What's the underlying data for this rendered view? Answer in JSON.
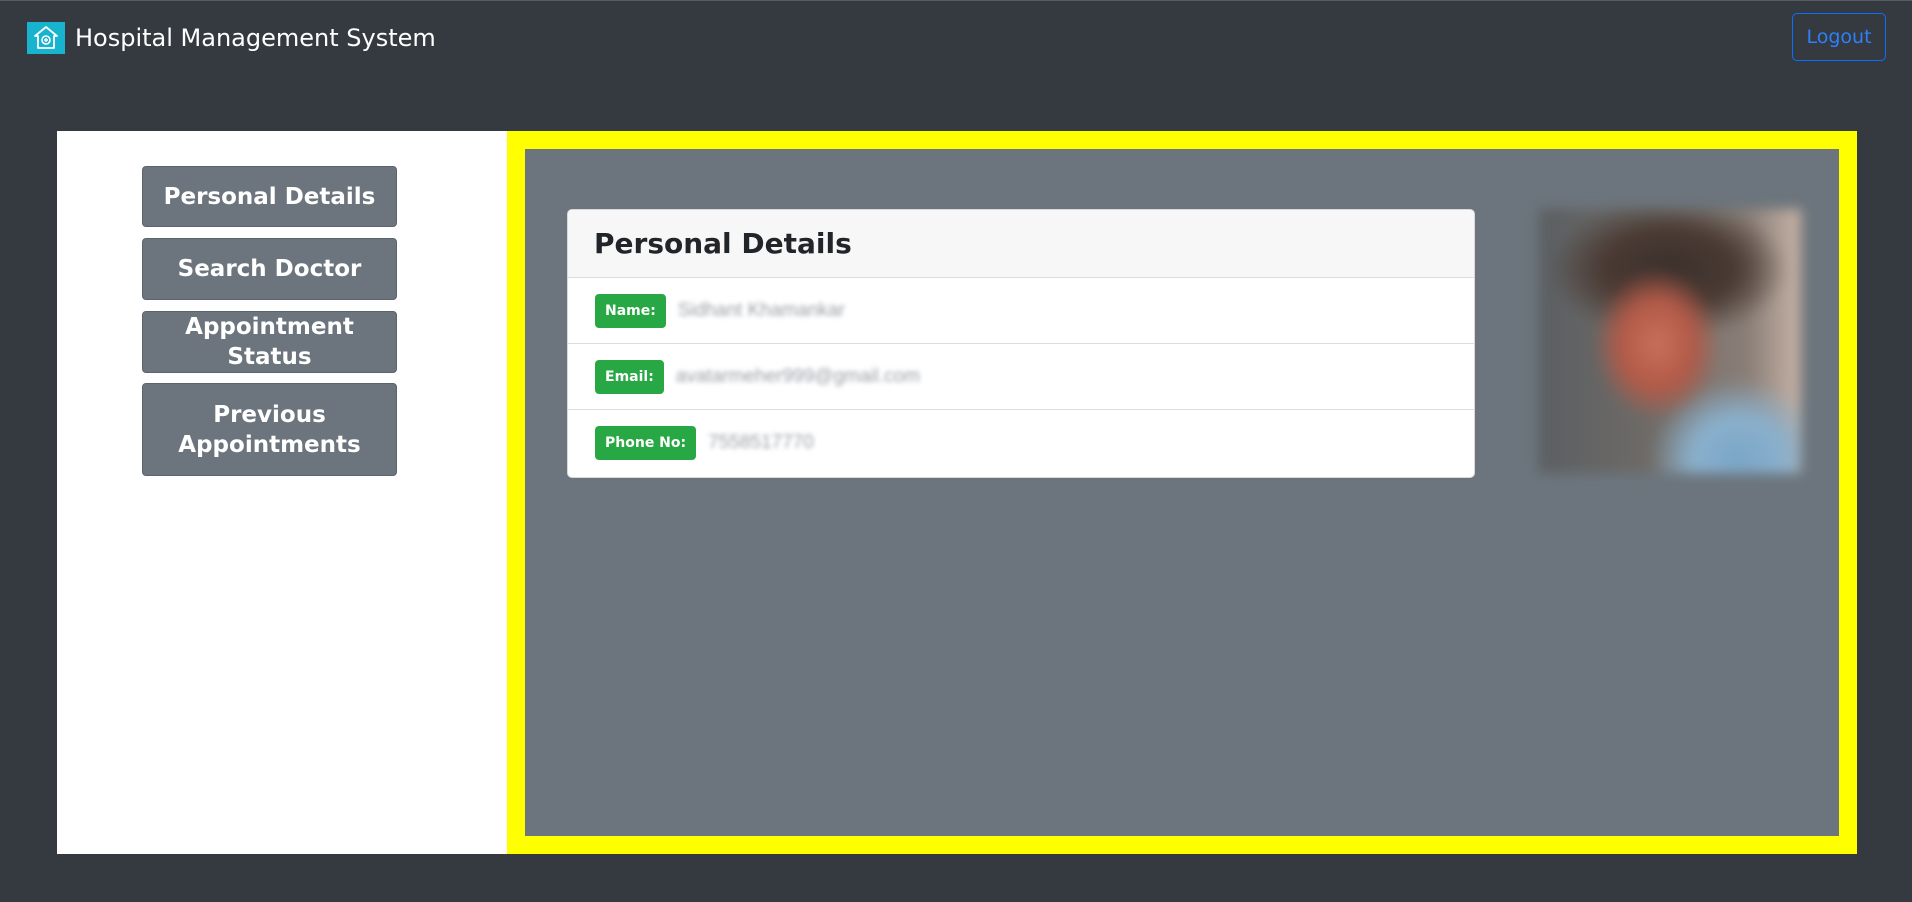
{
  "app": {
    "title": "Hospital Management System",
    "logout_label": "Logout"
  },
  "sidebar": {
    "items": [
      {
        "label": "Personal Details"
      },
      {
        "label": "Search Doctor"
      },
      {
        "label": "Appointment Status"
      },
      {
        "label": "Previous Appointments"
      }
    ]
  },
  "card": {
    "title": "Personal Details",
    "fields": [
      {
        "label": "Name:",
        "value": "Sidhant Khamankar"
      },
      {
        "label": "Email:",
        "value": "avatarmeher999@gmail.com"
      },
      {
        "label": "Phone No:",
        "value": "7558517770"
      }
    ]
  },
  "colors": {
    "navbar_bg": "#343a40",
    "sidebar_button": "#6c757d",
    "content_border": "#ffff00",
    "content_bg": "#6c757d",
    "badge": "#28a745",
    "logout": "#0d6efd",
    "logo_bg": "#17b3cf"
  },
  "icons": {
    "logo": "hospital-logo-icon"
  }
}
